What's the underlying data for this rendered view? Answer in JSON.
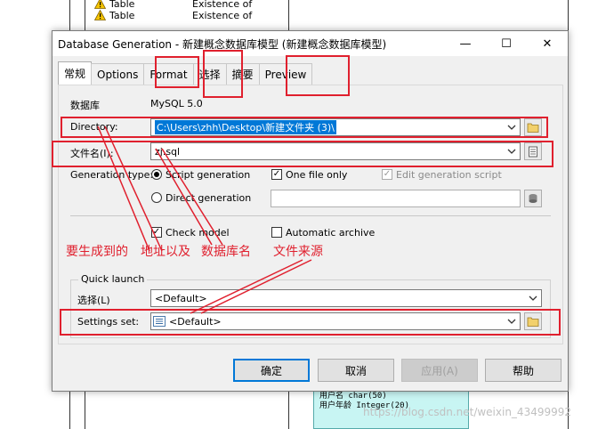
{
  "background": {
    "rows": [
      {
        "col1": "Table",
        "col2": "Existence of"
      },
      {
        "col1": "Table",
        "col2": "Existence of"
      }
    ],
    "entity_lines": [
      "用户名   char(50)",
      "用户年龄  Integer(20)"
    ],
    "watermark": "https://blog.csdn.net/weixin_43499992"
  },
  "dialog": {
    "title": "Database Generation - 新建概念数据库模型 (新建概念数据库模型)",
    "window_controls": {
      "minimize": "—",
      "maximize": "☐",
      "close": "✕"
    },
    "tabs": [
      {
        "label": "常规",
        "active": true
      },
      {
        "label": "Options",
        "active": false
      },
      {
        "label": "Format",
        "active": false
      },
      {
        "label": "选择",
        "active": false
      },
      {
        "label": "摘要",
        "active": false
      },
      {
        "label": "Preview",
        "active": false
      }
    ],
    "dbms_label": "数据库",
    "dbms_value": "MySQL 5.0",
    "directory_label": "Directory:",
    "directory_value": "C:\\Users\\zhh\\Desktop\\新建文件夹 (3)\\",
    "filename_label": "文件名(I):",
    "filename_value": "zj.sql",
    "generation_type_label": "Generation type:",
    "script_generation": "Script generation",
    "one_file_only": "One file only",
    "edit_generation_script": "Edit generation script",
    "direct_generation": "Direct generation",
    "check_model": "Check model",
    "automatic_archive": "Automatic archive",
    "quick_launch_title": "Quick launch",
    "selection_label": "选择(L)",
    "selection_value": "<Default>",
    "settings_set_label": "Settings set:",
    "settings_set_value": "<Default>",
    "buttons": {
      "ok": "确定",
      "cancel": "取消",
      "apply": "应用(A)",
      "help": "帮助"
    }
  },
  "annotations": {
    "text1": "要生成到的",
    "text2": "地址以及",
    "text3": "数据库名",
    "text4": "文件来源",
    "color": "#e0202e"
  }
}
